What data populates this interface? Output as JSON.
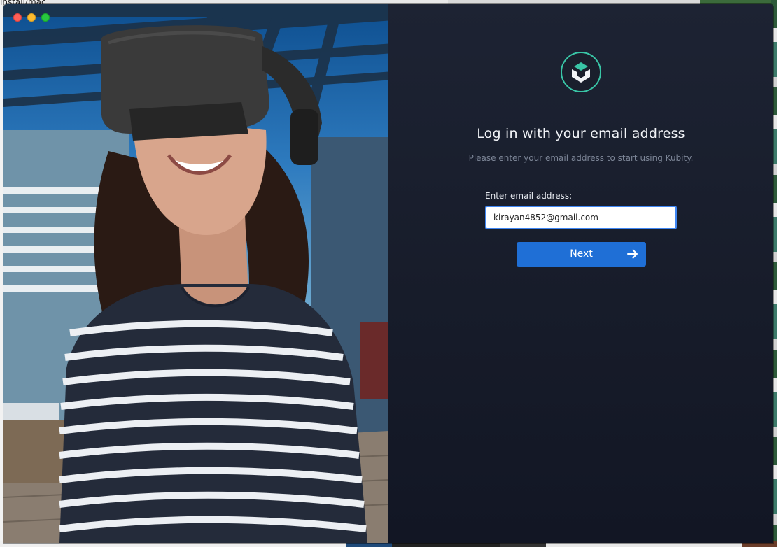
{
  "desktop": {
    "partial_text": "install/mac"
  },
  "window": {
    "controls": [
      "close",
      "minimize",
      "maximize"
    ]
  },
  "hero": {
    "image_subject": "woman-wearing-vr-headset"
  },
  "login": {
    "logo_icon": "kubity-logo-icon",
    "title": "Log in with your email address",
    "subtitle": "Please enter your email address to start using Kubity.",
    "email_label": "Enter email address:",
    "email_value": "kirayan4852@gmail.com",
    "next_label": "Next",
    "next_icon": "arrow-right-icon"
  },
  "colors": {
    "panel_bg": "#1b2030",
    "accent_blue": "#1f6fd6",
    "input_focus": "#3f86f3",
    "logo_teal": "#39c5a6"
  }
}
